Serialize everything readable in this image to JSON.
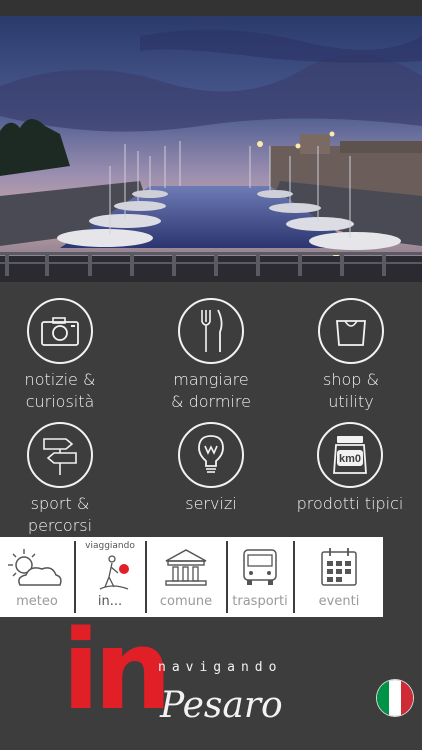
{
  "grid": {
    "tiles": [
      {
        "label_line1": "notizie &",
        "label_line2": "curiosità",
        "icon": "camera-icon"
      },
      {
        "label_line1": "mangiare",
        "label_line2": "& dormire",
        "icon": "fork-knife-icon"
      },
      {
        "label_line1": "shop &",
        "label_line2": "utility",
        "icon": "shopping-bag-icon"
      },
      {
        "label_line1": "sport &",
        "label_line2": "percorsi",
        "icon": "signpost-icon"
      },
      {
        "label_line1": "servizi",
        "label_line2": "",
        "icon": "lightbulb-icon"
      },
      {
        "label_line1": "prodotti tipici",
        "label_line2": "",
        "icon": "jar-icon"
      }
    ],
    "km0_text": "km0"
  },
  "strip": {
    "items": [
      {
        "label": "meteo",
        "icon": "weather-icon"
      },
      {
        "label": "in...",
        "sublabel": "viaggiando",
        "icon": "traveler-icon"
      },
      {
        "label": "comune",
        "icon": "town-hall-icon"
      },
      {
        "label": "trasporti",
        "icon": "bus-icon"
      },
      {
        "label": "eventi",
        "icon": "calendar-icon"
      }
    ]
  },
  "brand": {
    "logo_in": "in",
    "tagline": "navigando",
    "city": "Pesaro"
  },
  "colors": {
    "background": "#3d3d3d",
    "logo_red": "#e01f26",
    "flag_green": "#009246",
    "flag_white": "#ffffff",
    "flag_red": "#ce2b37"
  }
}
